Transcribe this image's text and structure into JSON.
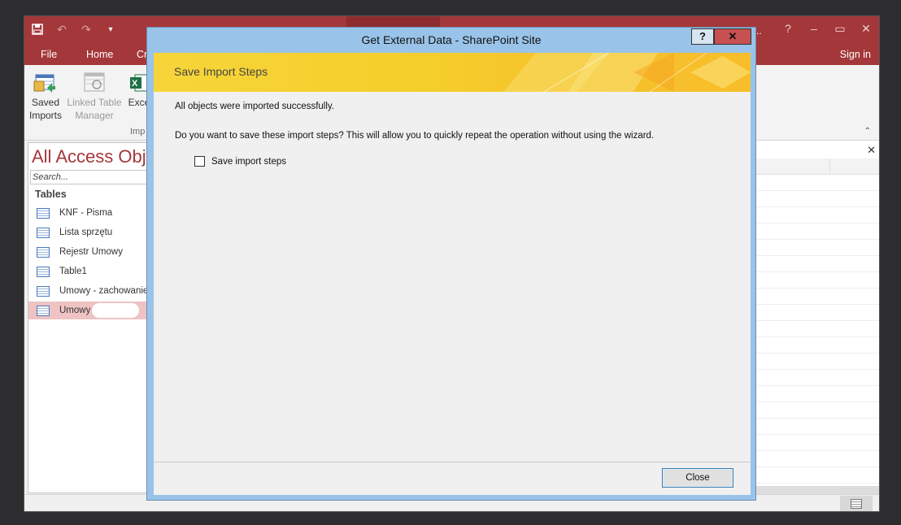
{
  "app": {
    "title_partial": "d...",
    "qat": {
      "save_icon": "save-icon",
      "undo_icon": "undo-icon",
      "redo_icon": "redo-icon",
      "customize_icon": "customize-qat-icon"
    },
    "window_controls": {
      "help": "?",
      "minimize": "–",
      "restore": "▭",
      "close": "✕"
    }
  },
  "tabs": {
    "file": "File",
    "home": "Home",
    "create": "Cr",
    "sign_in": "Sign in"
  },
  "ribbon": {
    "saved_imports": "Saved\nImports",
    "saved_imports_l1": "Saved",
    "saved_imports_l2": "Imports",
    "linked_table_l1": "Linked Table",
    "linked_table_l2": "Manager",
    "excel": "Exce",
    "group_label": "Imp",
    "collapse": "⌃"
  },
  "nav": {
    "title": "All Access Obje",
    "search_placeholder": "Search...",
    "group": "Tables",
    "items": [
      {
        "label": "KNF - Pisma"
      },
      {
        "label": "Lista sprzętu"
      },
      {
        "label": "Rejestr Umowy"
      },
      {
        "label": "Table1"
      },
      {
        "label": "Umowy - zachowanie"
      },
      {
        "label": "Umowy"
      }
    ]
  },
  "doc": {
    "close": "✕"
  },
  "dialog": {
    "title": "Get External Data - SharePoint Site",
    "help": "?",
    "close_glyph": "✕",
    "banner_title": "Save Import Steps",
    "message1": "All objects were imported successfully.",
    "message2": "Do you want to save these import steps? This will allow you to quickly repeat the operation without using the wizard.",
    "checkbox_label": "Save import steps",
    "close_button": "Close"
  },
  "colors": {
    "access_red": "#a4373a",
    "dialog_frame": "#99c3e8",
    "banner_yellow": "#f4cf2a",
    "selected_row": "#efc3c4"
  }
}
